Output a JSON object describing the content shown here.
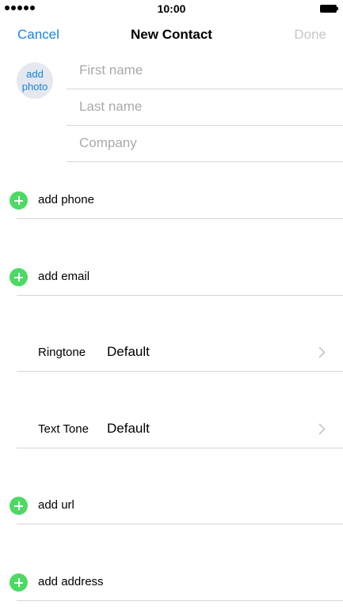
{
  "status_bar": {
    "time": "10:00",
    "signal_icon": "signal-dots-icon",
    "battery_icon": "battery-icon"
  },
  "nav": {
    "cancel_label": "Cancel",
    "title": "New Contact",
    "done_label": "Done"
  },
  "avatar": {
    "line1": "add",
    "line2": "photo"
  },
  "name_fields": {
    "first_placeholder": "First name",
    "last_placeholder": "Last name",
    "company_placeholder": "Company"
  },
  "rows": {
    "add_phone": "add phone",
    "add_email": "add email",
    "ringtone_label": "Ringtone",
    "ringtone_value": "Default",
    "text_tone_label": "Text Tone",
    "text_tone_value": "Default",
    "add_url": "add url",
    "add_address": "add address"
  },
  "colors": {
    "accent": "#1a82e0",
    "add_green": "#4cd964",
    "disabled": "#c7c7cc",
    "placeholder": "#a9a9ae",
    "separator": "#d6d6da"
  },
  "icons": {
    "plus": "add-circle-icon",
    "chevron": "chevron-right-icon"
  }
}
